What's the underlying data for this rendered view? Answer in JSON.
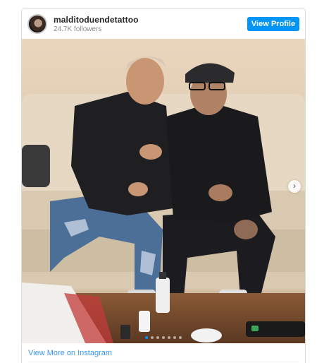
{
  "profile": {
    "username": "malditoduendetattoo",
    "followers": "24.7K followers",
    "view_profile_label": "View Profile"
  },
  "carousel": {
    "slide_count": 7,
    "active_index": 0
  },
  "footer": {
    "view_more_label": "View More on Instagram"
  },
  "colors": {
    "accent": "#0095f6",
    "link": "#3897f0"
  },
  "icons": {
    "next": "chevron-right-icon"
  }
}
